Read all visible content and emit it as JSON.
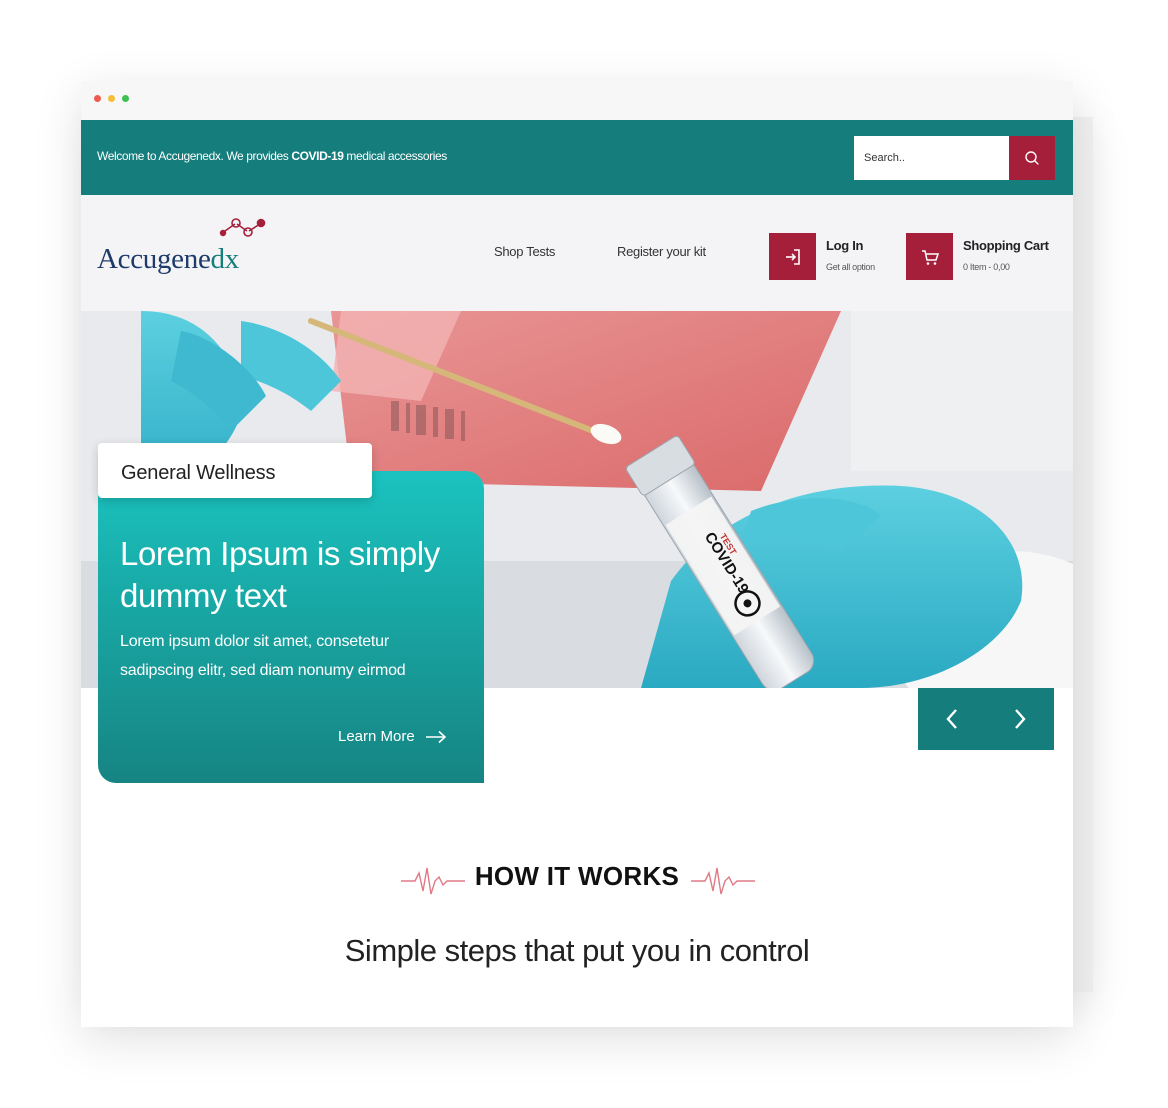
{
  "topbar": {
    "welcome_prefix": "Welcome to Accugenedx.   We provides ",
    "welcome_bold": "COVID-19",
    "welcome_suffix": " medical accessories",
    "search_placeholder": "Search.."
  },
  "header": {
    "logo_text": "Accugene",
    "logo_text_accent": "dx",
    "nav": {
      "shop_tests": "Shop Tests",
      "register_kit": "Register your kit"
    },
    "login": {
      "title": "Log In",
      "subtitle": "Get all option"
    },
    "cart": {
      "title": "Shopping Cart",
      "subtitle": "0 Item - 0,00"
    }
  },
  "hero": {
    "tag": "General Wellness",
    "title": "Lorem Ipsum is simply dummy text",
    "body": "Lorem ipsum dolor sit amet, consetetur sadipscing elitr, sed diam nonumy eirmod",
    "cta": "Learn More",
    "tube_label": "COVID-19",
    "tube_sublabel": "TEST"
  },
  "how_it_works": {
    "title": "HOW IT WORKS",
    "subtitle": "Simple steps that put you in control"
  },
  "colors": {
    "teal": "#157d7b",
    "teal_light": "#1bc3c0",
    "crimson": "#a51f3b",
    "navy": "#1e3a6b"
  }
}
